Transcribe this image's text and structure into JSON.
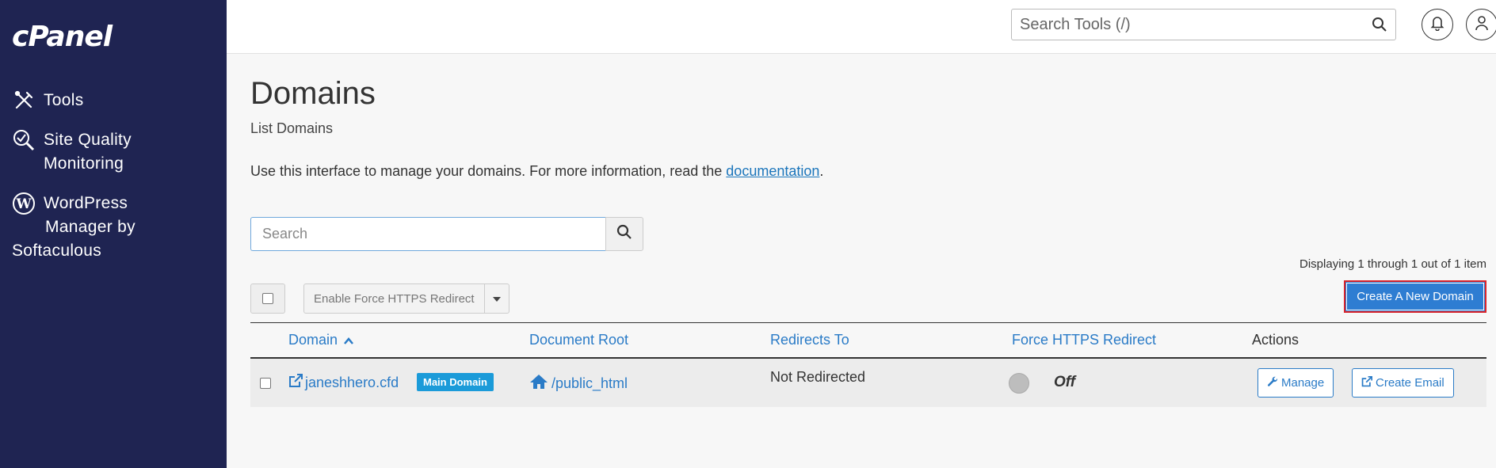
{
  "sidebar": {
    "logo": "cPanel",
    "items": [
      {
        "label_lines": [
          "Tools"
        ],
        "icon": "tools-icon"
      },
      {
        "label_lines": [
          "Site Quality",
          "Monitoring"
        ],
        "icon": "site-quality-icon"
      },
      {
        "label_lines": [
          "WordPress",
          "Manager by",
          "Softaculous"
        ],
        "icon": "wordpress-icon"
      }
    ]
  },
  "header": {
    "search_placeholder": "Search Tools (/)",
    "bell_icon": "bell-icon",
    "user_icon": "user-icon"
  },
  "page": {
    "title": "Domains",
    "subtitle": "List Domains",
    "intro_text": "Use this interface to manage your domains. For more information, read the ",
    "intro_link": "documentation",
    "intro_end": "."
  },
  "search": {
    "placeholder": "Search"
  },
  "displaying": "Displaying 1 through 1 out of 1 item",
  "toolbar": {
    "force_https_label": "Enable Force HTTPS Redirect",
    "create_label": "Create A New Domain"
  },
  "table": {
    "headers": {
      "domain": "Domain",
      "document_root": "Document Root",
      "redirects_to": "Redirects To",
      "force_https": "Force HTTPS Redirect",
      "actions": "Actions"
    },
    "rows": [
      {
        "domain": "janeshhero.cfd",
        "badge": "Main Domain",
        "document_root": "/public_html",
        "redirects_to": "Not Redirected",
        "force_https": "Off",
        "manage_label": "Manage",
        "email_label": "Create Email"
      }
    ]
  },
  "colors": {
    "sidebar_bg": "#1f2452",
    "link": "#2a7bc7",
    "primary_button": "#2e7dd2",
    "badge": "#1b9bd9",
    "highlight_border": "#d9242b"
  }
}
